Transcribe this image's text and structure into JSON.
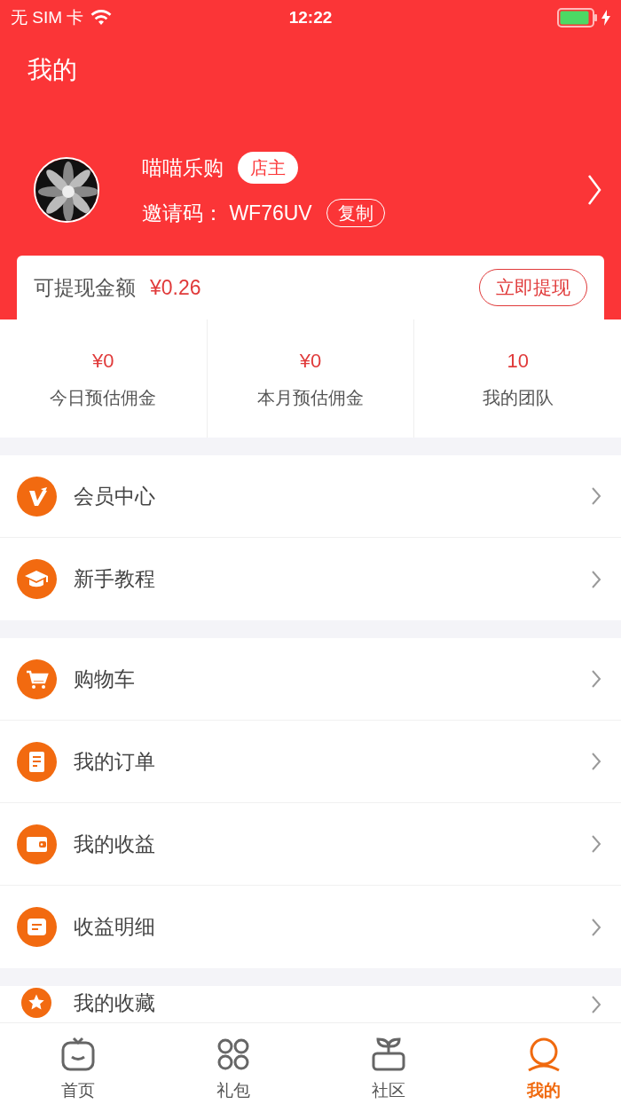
{
  "status_bar": {
    "carrier": "无 SIM 卡",
    "time": "12:22",
    "charging": true
  },
  "header": {
    "title": "我的"
  },
  "profile": {
    "name": "喵喵乐购",
    "role_badge": "店主",
    "invite_label": "邀请码：",
    "invite_code": "WF76UV",
    "copy_button": "复制"
  },
  "balance": {
    "label": "可提现金额",
    "amount": "¥0.26",
    "button": "立即提现"
  },
  "stats": [
    {
      "value": "¥0",
      "label": "今日预估佣金"
    },
    {
      "value": "¥0",
      "label": "本月预估佣金"
    },
    {
      "value": "10",
      "label": "我的团队"
    }
  ],
  "menu_groups": [
    [
      {
        "kind": "vip",
        "label": "会员中心"
      },
      {
        "kind": "course",
        "label": "新手教程"
      }
    ],
    [
      {
        "kind": "cart",
        "label": "购物车"
      },
      {
        "kind": "order",
        "label": "我的订单"
      },
      {
        "kind": "wallet",
        "label": "我的收益"
      },
      {
        "kind": "detail",
        "label": "收益明细"
      }
    ],
    [
      {
        "kind": "star",
        "label": "我的收藏"
      }
    ]
  ],
  "tab_bar": [
    {
      "kind": "home",
      "label": "首页",
      "selected": false
    },
    {
      "kind": "gift",
      "label": "礼包",
      "selected": false
    },
    {
      "kind": "community",
      "label": "社区",
      "selected": false
    },
    {
      "kind": "mine",
      "label": "我的",
      "selected": true
    }
  ]
}
